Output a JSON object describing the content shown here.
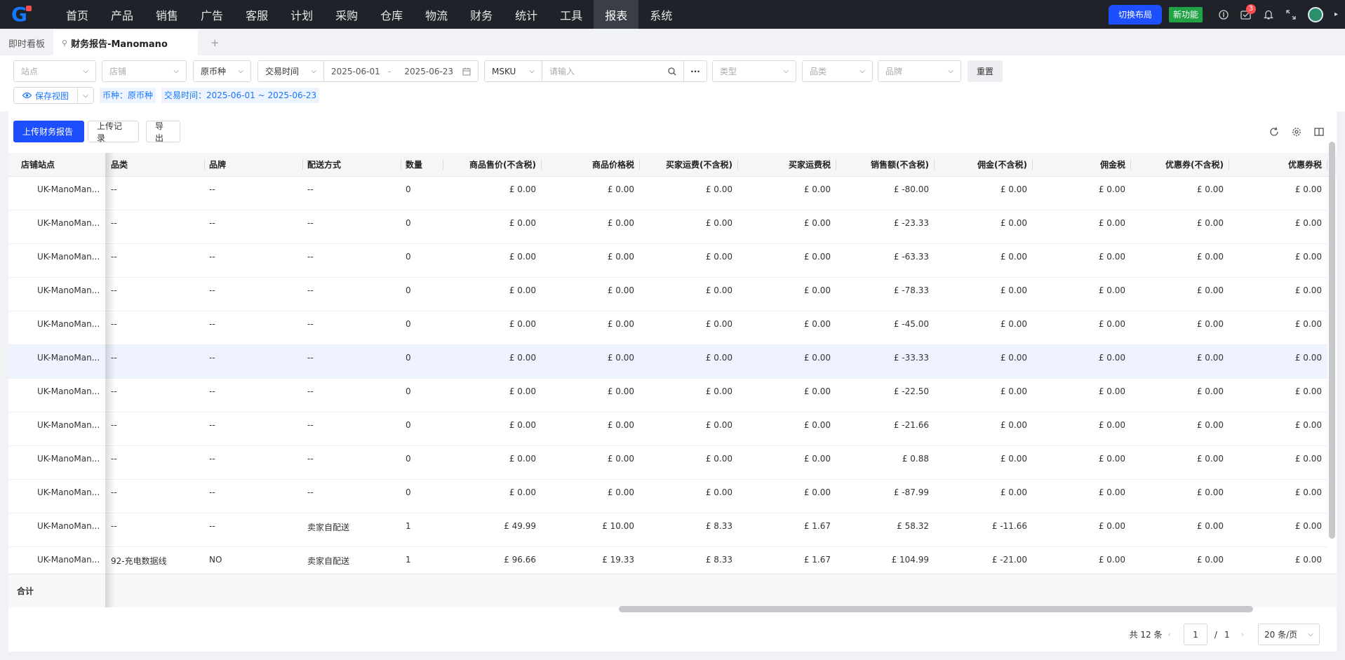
{
  "nav": {
    "items": [
      "首页",
      "产品",
      "销售",
      "广告",
      "客服",
      "计划",
      "采购",
      "仓库",
      "物流",
      "财务",
      "统计",
      "工具",
      "报表",
      "系统"
    ],
    "active": "报表",
    "switch_layout": "切换布局",
    "new_feature": "新功能",
    "notif_count": "3"
  },
  "tabs": {
    "dashboard": "即时看板",
    "active": "财务报告-Manomano",
    "add": "+"
  },
  "filters": {
    "site": "站点",
    "shop": "店铺",
    "currency": "原币种",
    "time_type": "交易时间",
    "date_start": "2025-06-01",
    "date_sep": "-",
    "date_end": "2025-06-23",
    "sku_type": "MSKU",
    "search_placeholder": "请输入",
    "more": "···",
    "type": "类型",
    "category": "品类",
    "brand": "品牌",
    "reset": "重置",
    "save_view": "保存视图",
    "chip_currency": "币种：原币种",
    "chip_time": "交易时间：2025-06-01 ~ 2025-06-23"
  },
  "toolbar": {
    "upload": "上传财务报告",
    "upload_log": "上传记录",
    "export": "导出"
  },
  "table": {
    "columns": [
      "店铺站点",
      "品类",
      "品牌",
      "配送方式",
      "数量",
      "商品售价(不含税)",
      "商品价格税",
      "买家运费(不含税)",
      "买家运费税",
      "销售额(不含税)",
      "佣金(不含税)",
      "佣金税",
      "优惠券(不含税)",
      "优惠券税"
    ],
    "rows": [
      [
        "UK-ManoMan...",
        "--",
        "--",
        "--",
        "0",
        "£ 0.00",
        "£ 0.00",
        "£ 0.00",
        "£ 0.00",
        "£ -80.00",
        "£ 0.00",
        "£ 0.00",
        "£ 0.00",
        "£ 0.00"
      ],
      [
        "UK-ManoMan...",
        "--",
        "--",
        "--",
        "0",
        "£ 0.00",
        "£ 0.00",
        "£ 0.00",
        "£ 0.00",
        "£ -23.33",
        "£ 0.00",
        "£ 0.00",
        "£ 0.00",
        "£ 0.00"
      ],
      [
        "UK-ManoMan...",
        "--",
        "--",
        "--",
        "0",
        "£ 0.00",
        "£ 0.00",
        "£ 0.00",
        "£ 0.00",
        "£ -63.33",
        "£ 0.00",
        "£ 0.00",
        "£ 0.00",
        "£ 0.00"
      ],
      [
        "UK-ManoMan...",
        "--",
        "--",
        "--",
        "0",
        "£ 0.00",
        "£ 0.00",
        "£ 0.00",
        "£ 0.00",
        "£ -78.33",
        "£ 0.00",
        "£ 0.00",
        "£ 0.00",
        "£ 0.00"
      ],
      [
        "UK-ManoMan...",
        "--",
        "--",
        "--",
        "0",
        "£ 0.00",
        "£ 0.00",
        "£ 0.00",
        "£ 0.00",
        "£ -45.00",
        "£ 0.00",
        "£ 0.00",
        "£ 0.00",
        "£ 0.00"
      ],
      [
        "UK-ManoMan...",
        "--",
        "--",
        "--",
        "0",
        "£ 0.00",
        "£ 0.00",
        "£ 0.00",
        "£ 0.00",
        "£ -33.33",
        "£ 0.00",
        "£ 0.00",
        "£ 0.00",
        "£ 0.00"
      ],
      [
        "UK-ManoMan...",
        "--",
        "--",
        "--",
        "0",
        "£ 0.00",
        "£ 0.00",
        "£ 0.00",
        "£ 0.00",
        "£ -22.50",
        "£ 0.00",
        "£ 0.00",
        "£ 0.00",
        "£ 0.00"
      ],
      [
        "UK-ManoMan...",
        "--",
        "--",
        "--",
        "0",
        "£ 0.00",
        "£ 0.00",
        "£ 0.00",
        "£ 0.00",
        "£ -21.66",
        "£ 0.00",
        "£ 0.00",
        "£ 0.00",
        "£ 0.00"
      ],
      [
        "UK-ManoMan...",
        "--",
        "--",
        "--",
        "0",
        "£ 0.00",
        "£ 0.00",
        "£ 0.00",
        "£ 0.00",
        "£ 0.88",
        "£ 0.00",
        "£ 0.00",
        "£ 0.00",
        "£ 0.00"
      ],
      [
        "UK-ManoMan...",
        "--",
        "--",
        "--",
        "0",
        "£ 0.00",
        "£ 0.00",
        "£ 0.00",
        "£ 0.00",
        "£ -87.99",
        "£ 0.00",
        "£ 0.00",
        "£ 0.00",
        "£ 0.00"
      ],
      [
        "UK-ManoMan...",
        "--",
        "--",
        "卖家自配送",
        "1",
        "£ 49.99",
        "£ 10.00",
        "£ 8.33",
        "£ 1.67",
        "£ 58.32",
        "£ -11.66",
        "£ 0.00",
        "£ 0.00",
        "£ 0.00"
      ],
      [
        "UK-ManoMan...",
        "92-充电数据线",
        "NO",
        "卖家自配送",
        "1",
        "£ 96.66",
        "£ 19.33",
        "£ 8.33",
        "£ 1.67",
        "£ 104.99",
        "£ -21.00",
        "£ 0.00",
        "£ 0.00",
        "£ 0.00"
      ]
    ],
    "highlight_row": 5,
    "sum_label": "合计"
  },
  "pager": {
    "total": "共 12 条",
    "page": "1",
    "sep": "/",
    "pages": "1",
    "page_size": "20 条/页",
    "prev": "‹",
    "next": "›"
  }
}
